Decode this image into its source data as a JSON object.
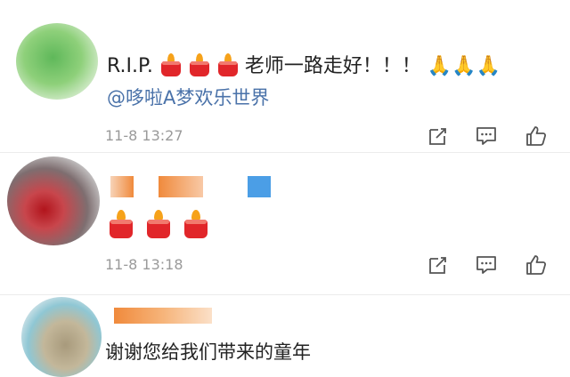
{
  "comments": [
    {
      "text_prefix": "R.I.P.",
      "candles": [
        "candle",
        "candle",
        "candle"
      ],
      "text_suffix": "老师一路走好！！！",
      "emoji_suffix": "🙏🙏🙏",
      "mention": "@哆啦A梦欢乐世界",
      "timestamp": "11-8 13:27",
      "actions": [
        "share-icon",
        "comment-icon",
        "like-icon"
      ]
    },
    {
      "username": "",
      "candles": [
        "candle",
        "candle",
        "candle"
      ],
      "timestamp": "11-8 13:18",
      "actions": [
        "share-icon",
        "comment-icon",
        "like-icon"
      ]
    },
    {
      "username": "",
      "text": "谢谢您给我们带来的童年"
    }
  ],
  "colors": {
    "mention": "#4a72a9",
    "timestamp": "#9a9a9a",
    "candle": "#e1262a",
    "flame": "#f6a21a"
  }
}
